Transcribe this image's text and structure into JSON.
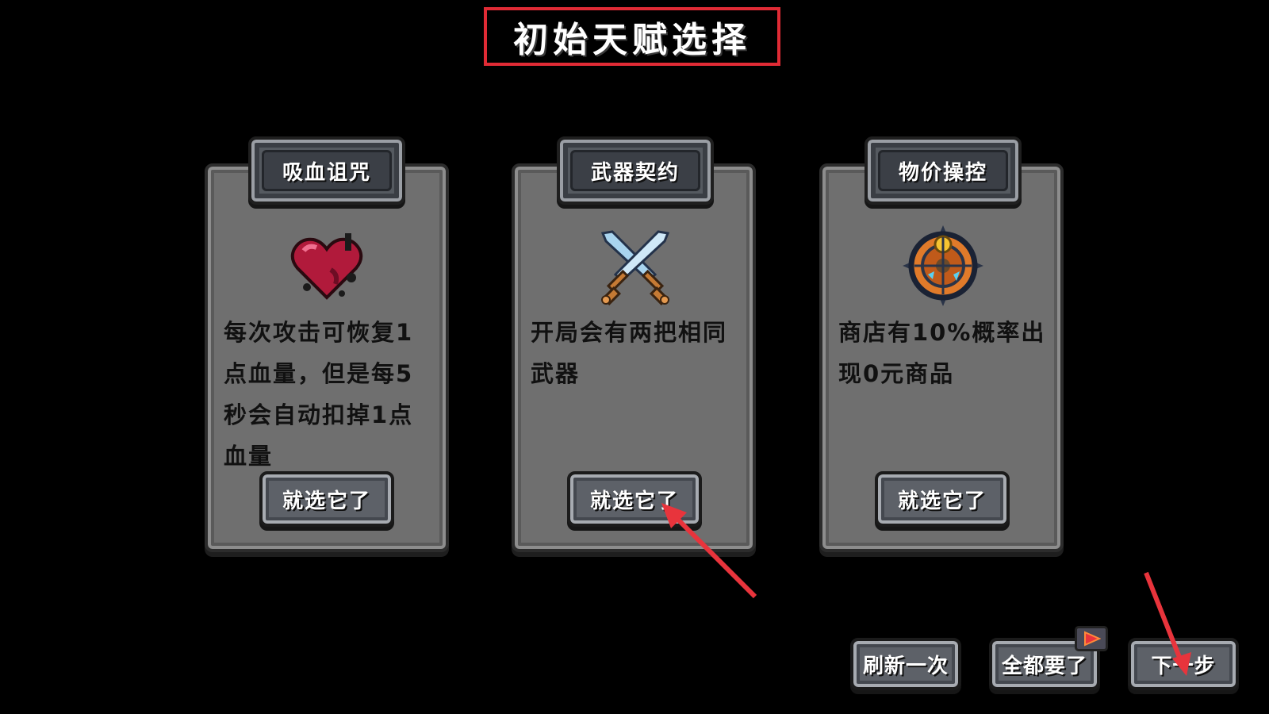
{
  "title": "初始天赋选择",
  "colors": {
    "title_border": "#e02b35",
    "annotation_arrow": "#e8343c",
    "card_bg": "#6f6f6f",
    "button_bg": "#5d6168",
    "description_text": "#111111"
  },
  "cards": [
    {
      "name": "吸血诅咒",
      "icon": "bleeding-heart-icon",
      "description": "每次攻击可恢复1点血量，但是每5秒会自动扣掉1点血量",
      "button_label": "就选它了"
    },
    {
      "name": "武器契约",
      "icon": "crossed-swords-icon",
      "description": "开局会有两把相同武器",
      "button_label": "就选它了"
    },
    {
      "name": "物价操控",
      "icon": "compass-emblem-icon",
      "description": "商店有10%概率出现0元商品",
      "button_label": "就选它了"
    }
  ],
  "bottom_buttons": {
    "refresh_label": "刷新一次",
    "take_all_label": "全都要了",
    "next_label": "下一步",
    "ad_icon": "play-video-icon"
  }
}
